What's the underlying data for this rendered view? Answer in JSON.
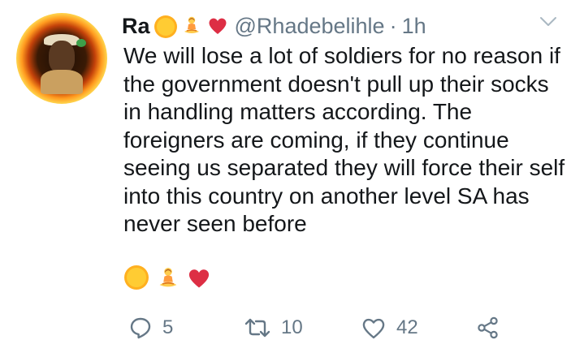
{
  "tweet": {
    "display_name": "Ra",
    "name_emojis": [
      "sun-emoji",
      "person-lotus-emoji",
      "red-heart-emoji"
    ],
    "handle": "@Rhadebelihle",
    "separator": "·",
    "time": "1h",
    "text": "We will lose a lot of soldiers for no reason if the government doesn't pull up their socks in handling matters according. The foreigners are coming, if they continue seeing us separated they will force their self into this country on another level SA has never seen before",
    "text_emojis": [
      "sun-emoji",
      "person-lotus-emoji",
      "red-heart-emoji"
    ]
  },
  "actions": {
    "replies": "5",
    "retweets": "10",
    "likes": "42"
  },
  "icons": {
    "more": "chevron-down-icon",
    "reply": "reply-icon",
    "retweet": "retweet-icon",
    "like": "heart-outline-icon",
    "share": "share-icon"
  },
  "colors": {
    "text": "#14171a",
    "muted": "#657786",
    "heart": "#e0245e",
    "sun": "#ffcc33"
  }
}
